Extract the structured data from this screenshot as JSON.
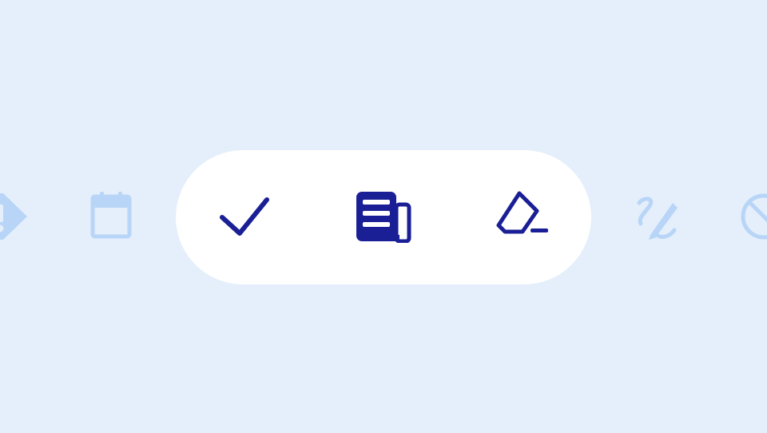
{
  "colors": {
    "background": "#e4effb",
    "pill": "#ffffff",
    "active_icon": "#1a1f96",
    "inactive_icon": "#b8d5f7"
  },
  "carousel": {
    "inactive_left": [
      "tag-alert-icon",
      "calendar-icon"
    ],
    "active": [
      "check-icon",
      "newspaper-icon",
      "eraser-icon"
    ],
    "inactive_right": [
      "draw-pencil-icon",
      "block-icon"
    ]
  }
}
